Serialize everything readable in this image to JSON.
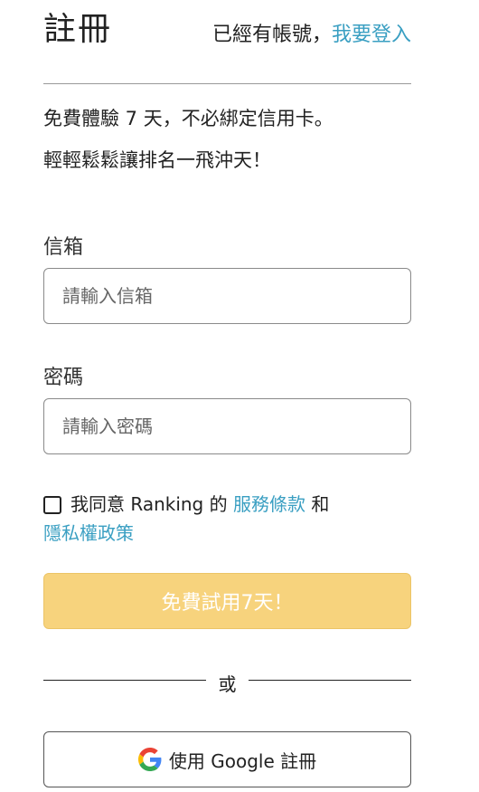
{
  "header": {
    "title": "註冊",
    "login_prompt": "已經有帳號，",
    "login_link": "我要登入"
  },
  "intro": {
    "line1": "免費體驗 7 天，不必綁定信用卡。",
    "line2": "輕輕鬆鬆讓排名一飛沖天！"
  },
  "form": {
    "email_label": "信箱",
    "email_placeholder": "請輸入信箱",
    "password_label": "密碼",
    "password_placeholder": "請輸入密碼"
  },
  "agreement": {
    "checked": false,
    "text_prefix": "我同意 Ranking 的",
    "terms_link": "服務條款",
    "conjunction": "和",
    "privacy_link": "隱私權政策"
  },
  "trial_button": "免費試用7天！",
  "divider_text": "或",
  "google_button": "使用 Google 註冊",
  "colors": {
    "link": "#3a9fc2",
    "trial_button_bg": "#f7d37d"
  }
}
